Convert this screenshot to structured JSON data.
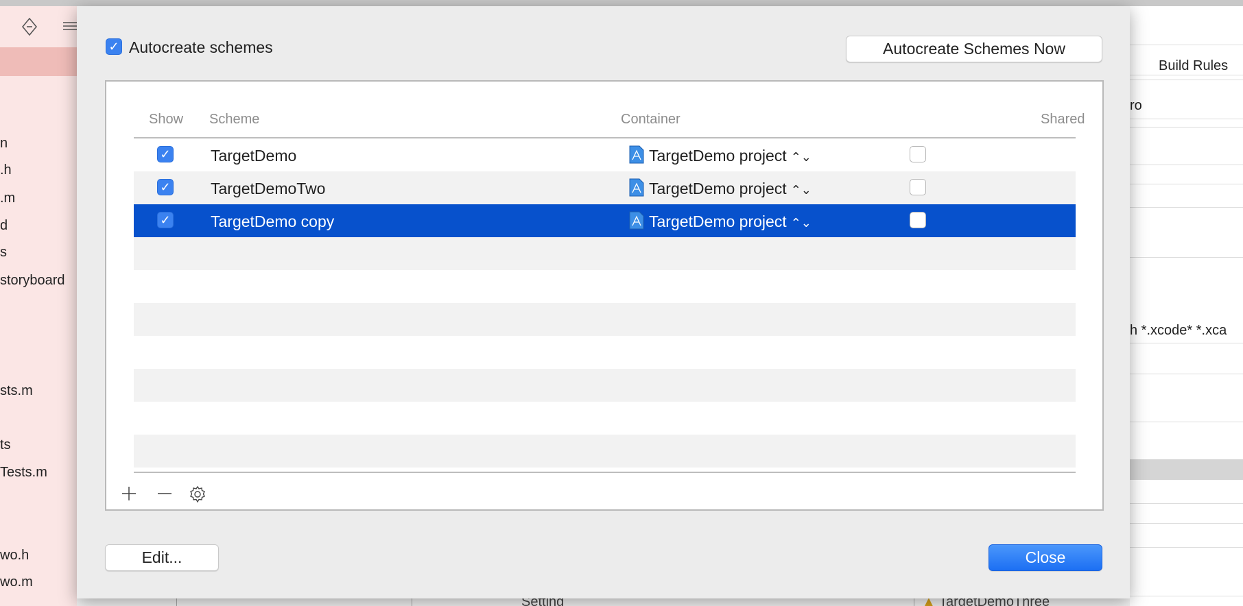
{
  "background": {
    "sidebar_items": [
      "n",
      ".h",
      ".m",
      "d",
      "s",
      "storyboard",
      "sts.m",
      "ts",
      "Tests.m",
      "wo.h",
      "wo.m"
    ],
    "right_panel": {
      "tab": "Build Rules",
      "value1": "ro",
      "value2": "h *.xcode* *.xca"
    },
    "bottom": {
      "setting": "Setting",
      "target": "TargetDemoThree"
    }
  },
  "dialog": {
    "autocreate_label": "Autocreate schemes",
    "autocreate_checked": true,
    "autocreate_now_button": "Autocreate Schemes Now",
    "columns": {
      "show": "Show",
      "scheme": "Scheme",
      "container": "Container",
      "shared": "Shared"
    },
    "rows": [
      {
        "show": true,
        "scheme": "TargetDemo",
        "container": "TargetDemo project",
        "shared": false,
        "selected": false
      },
      {
        "show": true,
        "scheme": "TargetDemoTwo",
        "container": "TargetDemo project",
        "shared": false,
        "selected": false
      },
      {
        "show": true,
        "scheme": "TargetDemo copy",
        "container": "TargetDemo project",
        "shared": false,
        "selected": true
      }
    ],
    "edit_button": "Edit...",
    "close_button": "Close",
    "colors": {
      "selection": "#0751cc",
      "accent": "#2b7bf6"
    }
  }
}
